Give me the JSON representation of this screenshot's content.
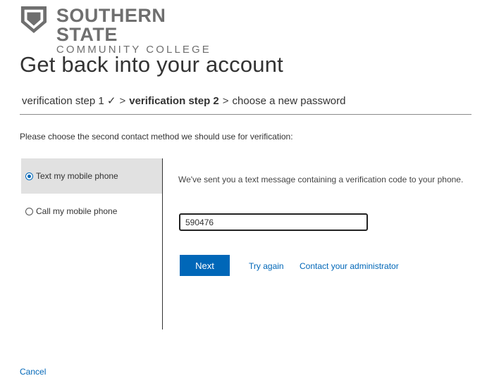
{
  "logo": {
    "line1": "SOUTHERN STATE",
    "line2": "COMMUNITY COLLEGE"
  },
  "page": {
    "title": "Get back into your account"
  },
  "steps": {
    "step1": "verification step 1 ✓",
    "separator": ">",
    "step2": "verification step 2",
    "step3": "choose a new password"
  },
  "instruction": "Please choose the second contact method we should use for verification:",
  "methods": [
    {
      "label": "Text my mobile phone",
      "selected": true
    },
    {
      "label": "Call my mobile phone",
      "selected": false
    }
  ],
  "verification": {
    "message": "We've sent you a text message containing a verification code to your phone.",
    "code_value": "590476"
  },
  "actions": {
    "next": "Next",
    "try_again": "Try again",
    "contact_admin": "Contact your administrator"
  },
  "footer": {
    "cancel": "Cancel"
  },
  "colors": {
    "accent": "#0067b8",
    "selected_bg": "#e1e1e1",
    "logo_gray": "#6f6f6f"
  }
}
